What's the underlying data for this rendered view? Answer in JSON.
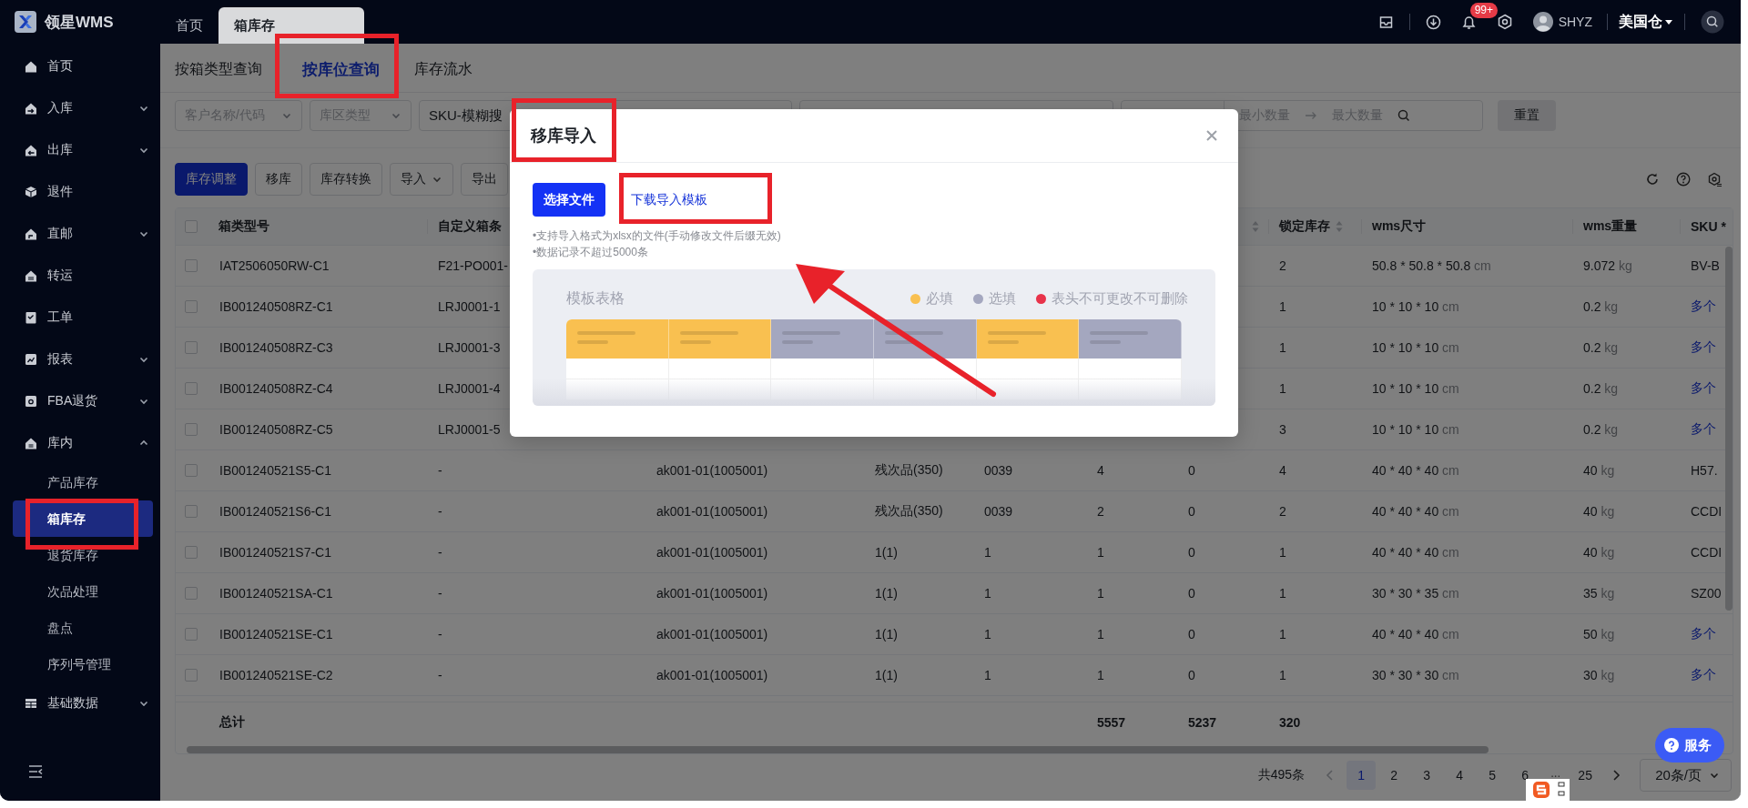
{
  "app": {
    "logo": "领星WMS"
  },
  "page_tabs": [
    {
      "label": "首页",
      "selected": false
    },
    {
      "label": "箱库存",
      "selected": true
    }
  ],
  "header": {
    "notification_badge": "99+",
    "user_name": "SHYZ",
    "warehouse": "美国仓"
  },
  "sidebar": {
    "items": [
      {
        "label": "首页",
        "kind": "link",
        "selected": false
      },
      {
        "label": "入库",
        "kind": "group",
        "expanded": false,
        "selected": false
      },
      {
        "label": "出库",
        "kind": "group",
        "expanded": false,
        "selected": false
      },
      {
        "label": "退件",
        "kind": "link",
        "selected": false
      },
      {
        "label": "直邮",
        "kind": "group",
        "expanded": false,
        "selected": false
      },
      {
        "label": "转运",
        "kind": "link",
        "selected": false
      },
      {
        "label": "工单",
        "kind": "link",
        "selected": false
      },
      {
        "label": "报表",
        "kind": "group",
        "expanded": false,
        "selected": false
      },
      {
        "label": "FBA退货",
        "kind": "group",
        "expanded": false,
        "selected": false
      },
      {
        "label": "库内",
        "kind": "group",
        "expanded": true,
        "selected": false,
        "children": [
          {
            "label": "产品库存",
            "selected": false
          },
          {
            "label": "箱库存",
            "selected": true
          },
          {
            "label": "退货库存",
            "selected": false
          },
          {
            "label": "次品处理",
            "selected": false
          },
          {
            "label": "盘点",
            "selected": false
          },
          {
            "label": "序列号管理",
            "selected": false
          }
        ]
      },
      {
        "label": "基础数据",
        "kind": "group",
        "expanded": false,
        "selected": false
      }
    ]
  },
  "sub_tabs": [
    {
      "label": "按箱类型查询",
      "selected": false
    },
    {
      "label": "按库位查询",
      "selected": true
    },
    {
      "label": "库存流水",
      "selected": false
    }
  ],
  "filters": [
    {
      "kind": "select",
      "placeholder": "客户名称/代码"
    },
    {
      "kind": "select",
      "placeholder": "库区类型"
    },
    {
      "kind": "search_group",
      "value": "SKU-模糊搜"
    },
    {
      "kind": "search_group"
    },
    {
      "kind": "range",
      "min_placeholder": "最小数量",
      "max_placeholder": "最大数量"
    }
  ],
  "reset_button": "重置",
  "toolbar": {
    "buttons": [
      {
        "label": "库存调整",
        "kind": "primary"
      },
      {
        "label": "移库",
        "kind": "default"
      },
      {
        "label": "库存转换",
        "kind": "default"
      },
      {
        "label": "导入",
        "kind": "dropdown"
      },
      {
        "label": "导出",
        "kind": "default"
      }
    ]
  },
  "table": {
    "select_all_checked": false,
    "columns": [
      {
        "label": "箱类型号",
        "sortable": false
      },
      {
        "label": "自定义箱条",
        "sortable": false
      },
      {
        "sortable": true
      },
      {
        "label": "锁定库存",
        "sortable": true
      },
      {
        "label": "wms尺寸",
        "sortable": false
      },
      {
        "label": "wms重量",
        "sortable": false
      },
      {
        "label": "SKU *",
        "sortable": false
      }
    ],
    "rows": [
      {
        "checked": false,
        "box_type_no": "IAT2506050RW-C1",
        "custom_box_barcode": "F21-PO001-",
        "locked_stock": "2",
        "wms_size": "50.8 * 50.8 * 50.8",
        "wms_size_unit": "cm",
        "wms_weight": "9.072",
        "wms_weight_unit": "kg",
        "sku": "BV-B",
        "sku_link": false
      },
      {
        "checked": false,
        "box_type_no": "IB001240508RZ-C1",
        "custom_box_barcode": "LRJ0001-1",
        "locked_stock": "1",
        "wms_size": "10 * 10 * 10",
        "wms_size_unit": "cm",
        "wms_weight": "0.2",
        "wms_weight_unit": "kg",
        "sku": "多个",
        "sku_link": true
      },
      {
        "checked": false,
        "box_type_no": "IB001240508RZ-C3",
        "custom_box_barcode": "LRJ0001-3",
        "locked_stock": "1",
        "wms_size": "10 * 10 * 10",
        "wms_size_unit": "cm",
        "wms_weight": "0.2",
        "wms_weight_unit": "kg",
        "sku": "多个",
        "sku_link": true
      },
      {
        "checked": false,
        "box_type_no": "IB001240508RZ-C4",
        "custom_box_barcode": "LRJ0001-4",
        "locked_stock": "1",
        "wms_size": "10 * 10 * 10",
        "wms_size_unit": "cm",
        "wms_weight": "0.2",
        "wms_weight_unit": "kg",
        "sku": "多个",
        "sku_link": true
      },
      {
        "checked": false,
        "box_type_no": "IB001240508RZ-C5",
        "custom_box_barcode": "LRJ0001-5",
        "locked_stock": "3",
        "wms_size": "10 * 10 * 10",
        "wms_size_unit": "cm",
        "wms_weight": "0.2",
        "wms_weight_unit": "kg",
        "sku": "多个",
        "sku_link": true
      },
      {
        "checked": false,
        "box_type_no": "IB001240521S5-C1",
        "custom_box_barcode": "-",
        "column_3": "ak001-01(1005001)",
        "column_4": "残次品(350)",
        "column_5": "0039",
        "column_6": "4",
        "column_7": "0",
        "locked_stock": "4",
        "wms_size": "40 * 40 * 40",
        "wms_size_unit": "cm",
        "wms_weight": "40",
        "wms_weight_unit": "kg",
        "sku": "H57.",
        "sku_link": false
      },
      {
        "checked": false,
        "box_type_no": "IB001240521S6-C1",
        "custom_box_barcode": "-",
        "column_3": "ak001-01(1005001)",
        "column_4": "残次品(350)",
        "column_5": "0039",
        "column_6": "2",
        "column_7": "0",
        "locked_stock": "2",
        "wms_size": "40 * 40 * 40",
        "wms_size_unit": "cm",
        "wms_weight": "40",
        "wms_weight_unit": "kg",
        "sku": "CCDI",
        "sku_link": false
      },
      {
        "checked": false,
        "box_type_no": "IB001240521S7-C1",
        "custom_box_barcode": "-",
        "column_3": "ak001-01(1005001)",
        "column_4": "1(1)",
        "column_5": "1",
        "column_6": "1",
        "column_7": "0",
        "locked_stock": "1",
        "wms_size": "40 * 40 * 40",
        "wms_size_unit": "cm",
        "wms_weight": "40",
        "wms_weight_unit": "kg",
        "sku": "CCDI",
        "sku_link": false
      },
      {
        "checked": false,
        "box_type_no": "IB001240521SA-C1",
        "custom_box_barcode": "-",
        "column_3": "ak001-01(1005001)",
        "column_4": "1(1)",
        "column_5": "1",
        "column_6": "1",
        "column_7": "0",
        "locked_stock": "1",
        "wms_size": "30 * 30 * 35",
        "wms_size_unit": "cm",
        "wms_weight": "35",
        "wms_weight_unit": "kg",
        "sku": "SZ00",
        "sku_link": false
      },
      {
        "checked": false,
        "box_type_no": "IB001240521SE-C1",
        "custom_box_barcode": "-",
        "column_3": "ak001-01(1005001)",
        "column_4": "1(1)",
        "column_5": "1",
        "column_6": "1",
        "column_7": "0",
        "locked_stock": "1",
        "wms_size": "40 * 40 * 40",
        "wms_size_unit": "cm",
        "wms_weight": "50",
        "wms_weight_unit": "kg",
        "sku": "多个",
        "sku_link": true
      },
      {
        "checked": false,
        "box_type_no": "IB001240521SE-C2",
        "custom_box_barcode": "-",
        "column_3": "ak001-01(1005001)",
        "column_4": "1(1)",
        "column_5": "1",
        "column_6": "1",
        "column_7": "0",
        "locked_stock": "1",
        "wms_size": "30 * 30 * 30",
        "wms_size_unit": "cm",
        "wms_weight": "30",
        "wms_weight_unit": "kg",
        "sku": "多个",
        "sku_link": true
      }
    ],
    "totals": {
      "box_type_no": "总计",
      "column_6": "5557",
      "column_7": "5237",
      "locked_stock": "320"
    }
  },
  "pagination": {
    "total": "共495条",
    "pages": [
      {
        "label": "1",
        "kind": "page",
        "selected": true
      },
      {
        "label": "2",
        "kind": "page",
        "selected": false
      },
      {
        "label": "3",
        "kind": "page",
        "selected": false
      },
      {
        "label": "4",
        "kind": "page",
        "selected": false
      },
      {
        "label": "5",
        "kind": "page",
        "selected": false
      },
      {
        "label": "6",
        "kind": "page",
        "selected": false
      },
      {
        "label": "···",
        "kind": "ellipsis"
      },
      {
        "label": "25",
        "kind": "page",
        "selected": false
      }
    ],
    "page_size": "20条/页"
  },
  "service_button": "服务",
  "modal": {
    "title": "移库导入",
    "select_button": "选择文件",
    "template_link": "下载导入模板",
    "notes": [
      "•支持导入格式为xlsx的文件(手动修改文件后缀无效)",
      "•数据记录不超过5000条"
    ],
    "template_preview": {
      "title": "模板表格",
      "legend": [
        {
          "label": "必填",
          "kind": "required",
          "color": "#f9c050"
        },
        {
          "label": "选填",
          "kind": "optional",
          "color": "#a4a7bf"
        },
        {
          "label": "表头不可更改不可删除",
          "kind": "locked",
          "color": "#e8334a"
        }
      ],
      "columns": [
        {
          "kind": "required"
        },
        {
          "kind": "required"
        },
        {
          "kind": "optional"
        },
        {
          "kind": "optional"
        },
        {
          "kind": "required"
        },
        {
          "kind": "optional"
        }
      ]
    }
  }
}
